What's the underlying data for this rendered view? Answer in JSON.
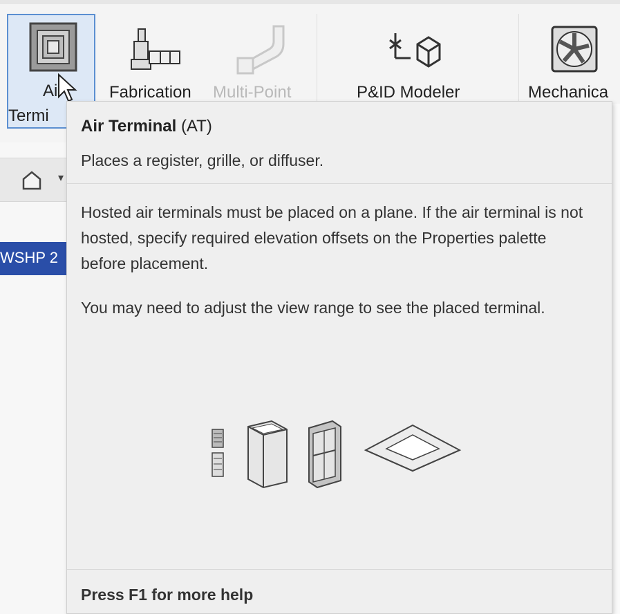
{
  "ribbon": {
    "buttons": [
      {
        "label_line1": "Air",
        "label_line2": "Termi",
        "icon": "air-terminal-icon",
        "state": "hovered"
      },
      {
        "label": "Fabrication",
        "icon": "fabrication-icon"
      },
      {
        "label": "Multi-Point",
        "icon": "multi-point-icon",
        "state": "disabled"
      },
      {
        "label": "P&ID Modeler",
        "icon": "pid-modeler-icon"
      },
      {
        "label": "Mechanica",
        "icon": "mechanical-equipment-icon"
      }
    ]
  },
  "view": {
    "label": "WSHP 2"
  },
  "tooltip": {
    "title": "Air Terminal",
    "shortcut": "(AT)",
    "description": "Places a register, grille, or diffuser.",
    "paragraph1": "Hosted air terminals must be placed on a plane. If the air terminal is not hosted, specify required elevation offsets on the Properties palette before placement.",
    "paragraph2": "You may need to adjust the view range to see the placed terminal.",
    "footer": "Press F1 for more help"
  },
  "colors": {
    "selection_blue": "#2a4ea8",
    "hover_fill": "#dde8f6",
    "hover_border": "#5b8fd1"
  }
}
